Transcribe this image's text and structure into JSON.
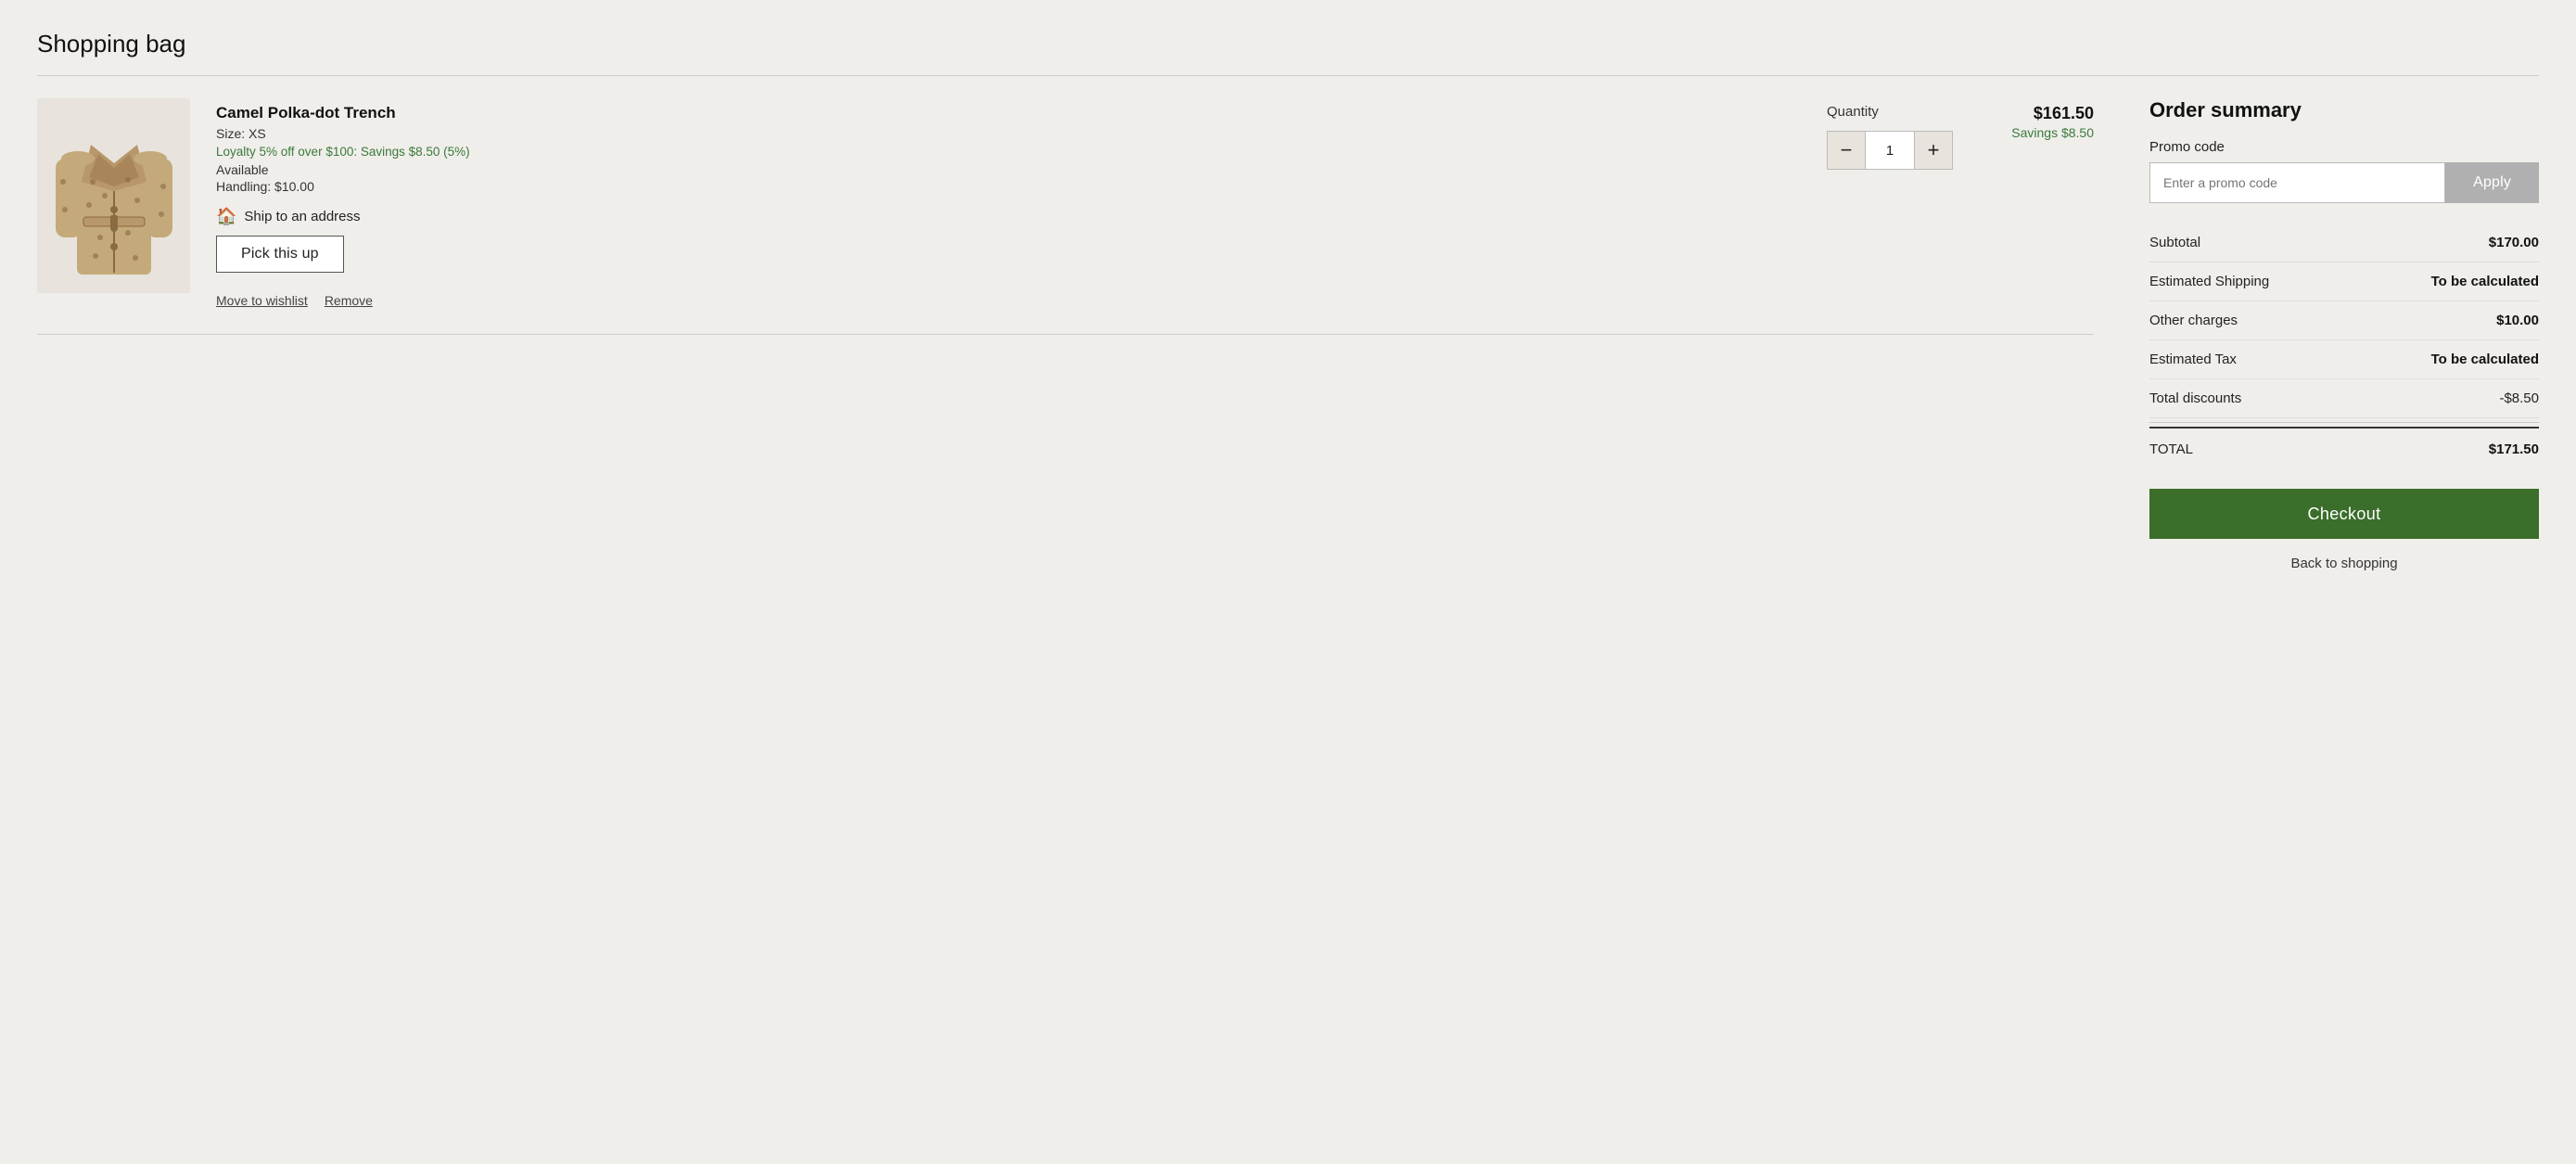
{
  "page": {
    "title": "Shopping bag"
  },
  "cart": {
    "item": {
      "name": "Camel Polka-dot Trench",
      "size_label": "Size: XS",
      "loyalty_text": "Loyalty 5% off over $100: Savings $8.50 (5%)",
      "availability": "Available",
      "handling": "Handling: $10.00",
      "ship_label": "Ship to an address",
      "pickup_label": "Pick this up",
      "quantity_label": "Quantity",
      "quantity_value": "1",
      "qty_minus": "−",
      "qty_plus": "+",
      "price": "$161.50",
      "savings": "Savings $8.50",
      "move_wishlist": "Move to wishlist",
      "remove": "Remove"
    }
  },
  "order_summary": {
    "title": "Order summary",
    "promo_label": "Promo code",
    "promo_placeholder": "Enter a promo code",
    "apply_label": "Apply",
    "rows": [
      {
        "label": "Subtotal",
        "value": "$170.00",
        "bold": true
      },
      {
        "label": "Estimated Shipping",
        "value": "To be calculated",
        "bold": true
      },
      {
        "label": "Other charges",
        "value": "$10.00",
        "bold": true
      },
      {
        "label": "Estimated Tax",
        "value": "To be calculated",
        "bold": true
      },
      {
        "label": "Total discounts",
        "value": "-$8.50",
        "bold": false
      }
    ],
    "total_label": "TOTAL",
    "total_value": "$171.50",
    "checkout_label": "Checkout",
    "back_label": "Back to shopping"
  }
}
